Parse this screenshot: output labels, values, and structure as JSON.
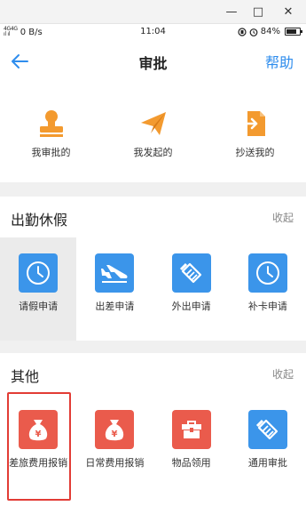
{
  "window": {
    "minimize_glyph": "—",
    "maximize_glyph": "□",
    "close_glyph": "✕"
  },
  "status_bar": {
    "signal_top": "4G4G",
    "signal_bottom": "ıl ıl",
    "speed": "0 B/s",
    "time": "11:04",
    "icons": [
      "cast-icon",
      "alarm-icon"
    ],
    "battery_pct": "84%"
  },
  "header": {
    "title": "审批",
    "help": "帮助",
    "back_icon": "arrow-left-icon"
  },
  "colors": {
    "accent": "#2f8ded",
    "tile_blue": "#3b95ea",
    "tile_red": "#ea5b4c",
    "orange_icon": "#f39a2f",
    "highlight": "#e23c35"
  },
  "quick": [
    {
      "label": "我审批的",
      "icon": "stamp-icon"
    },
    {
      "label": "我发起的",
      "icon": "paper-plane-icon"
    },
    {
      "label": "抄送我的",
      "icon": "forward-doc-icon"
    }
  ],
  "section_attendance": {
    "title": "出勤休假",
    "collapse": "收起",
    "items": [
      {
        "label": "请假申请",
        "icon": "clock-icon",
        "color": "blue"
      },
      {
        "label": "出差申请",
        "icon": "airplane-icon",
        "color": "blue"
      },
      {
        "label": "外出申请",
        "icon": "handshake-icon",
        "color": "blue"
      },
      {
        "label": "补卡申请",
        "icon": "clock-icon",
        "color": "blue"
      }
    ]
  },
  "section_other": {
    "title": "其他",
    "collapse": "收起",
    "items": [
      {
        "label": "差旅费用报销",
        "icon": "money-bag-icon",
        "color": "red"
      },
      {
        "label": "日常费用报销",
        "icon": "money-bag-icon",
        "color": "red"
      },
      {
        "label": "物品领用",
        "icon": "toolbox-icon",
        "color": "red"
      },
      {
        "label": "通用审批",
        "icon": "handshake-icon",
        "color": "blue"
      }
    ]
  }
}
